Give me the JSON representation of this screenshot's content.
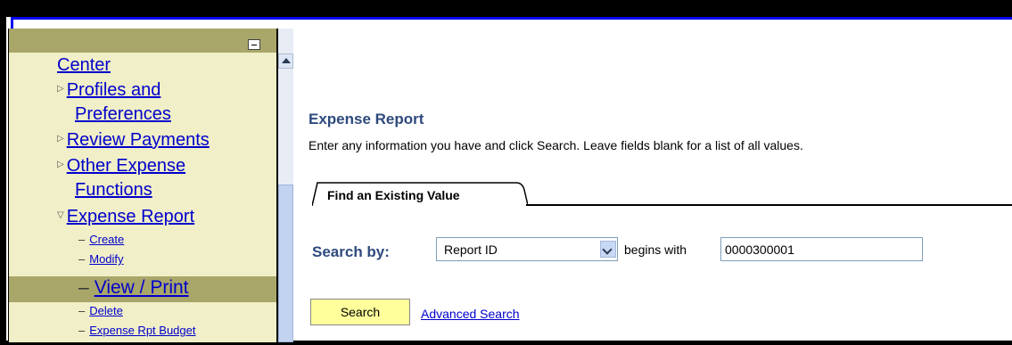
{
  "nav": {
    "items": [
      {
        "label": "Center"
      },
      {
        "label": "Profiles and"
      },
      {
        "label": "Preferences"
      },
      {
        "label": "Review Payments"
      },
      {
        "label": "Other Expense"
      },
      {
        "label": "Functions"
      },
      {
        "label": "Expense Report"
      }
    ],
    "sub_items": [
      {
        "label": "Create"
      },
      {
        "label": "Modify"
      },
      {
        "label": "View / Print"
      },
      {
        "label": "Delete"
      },
      {
        "label": "Expense Rpt Budget"
      }
    ]
  },
  "page": {
    "title": "Expense Report",
    "instructions": "Enter any information you have and click Search. Leave fields blank for a list of all values."
  },
  "tab": {
    "label": "Find an Existing Value"
  },
  "search": {
    "search_by_label": "Search by:",
    "field": "Report ID",
    "operator": "begins with",
    "value": "0000300001",
    "button": "Search",
    "advanced_link": "Advanced Search"
  },
  "colors": {
    "nav_background": "#f0efc7",
    "nav_selected": "#a9a66a",
    "title_color": "#2e4a7d",
    "link_color": "#0000cc",
    "search_button": "#ffff9c"
  }
}
